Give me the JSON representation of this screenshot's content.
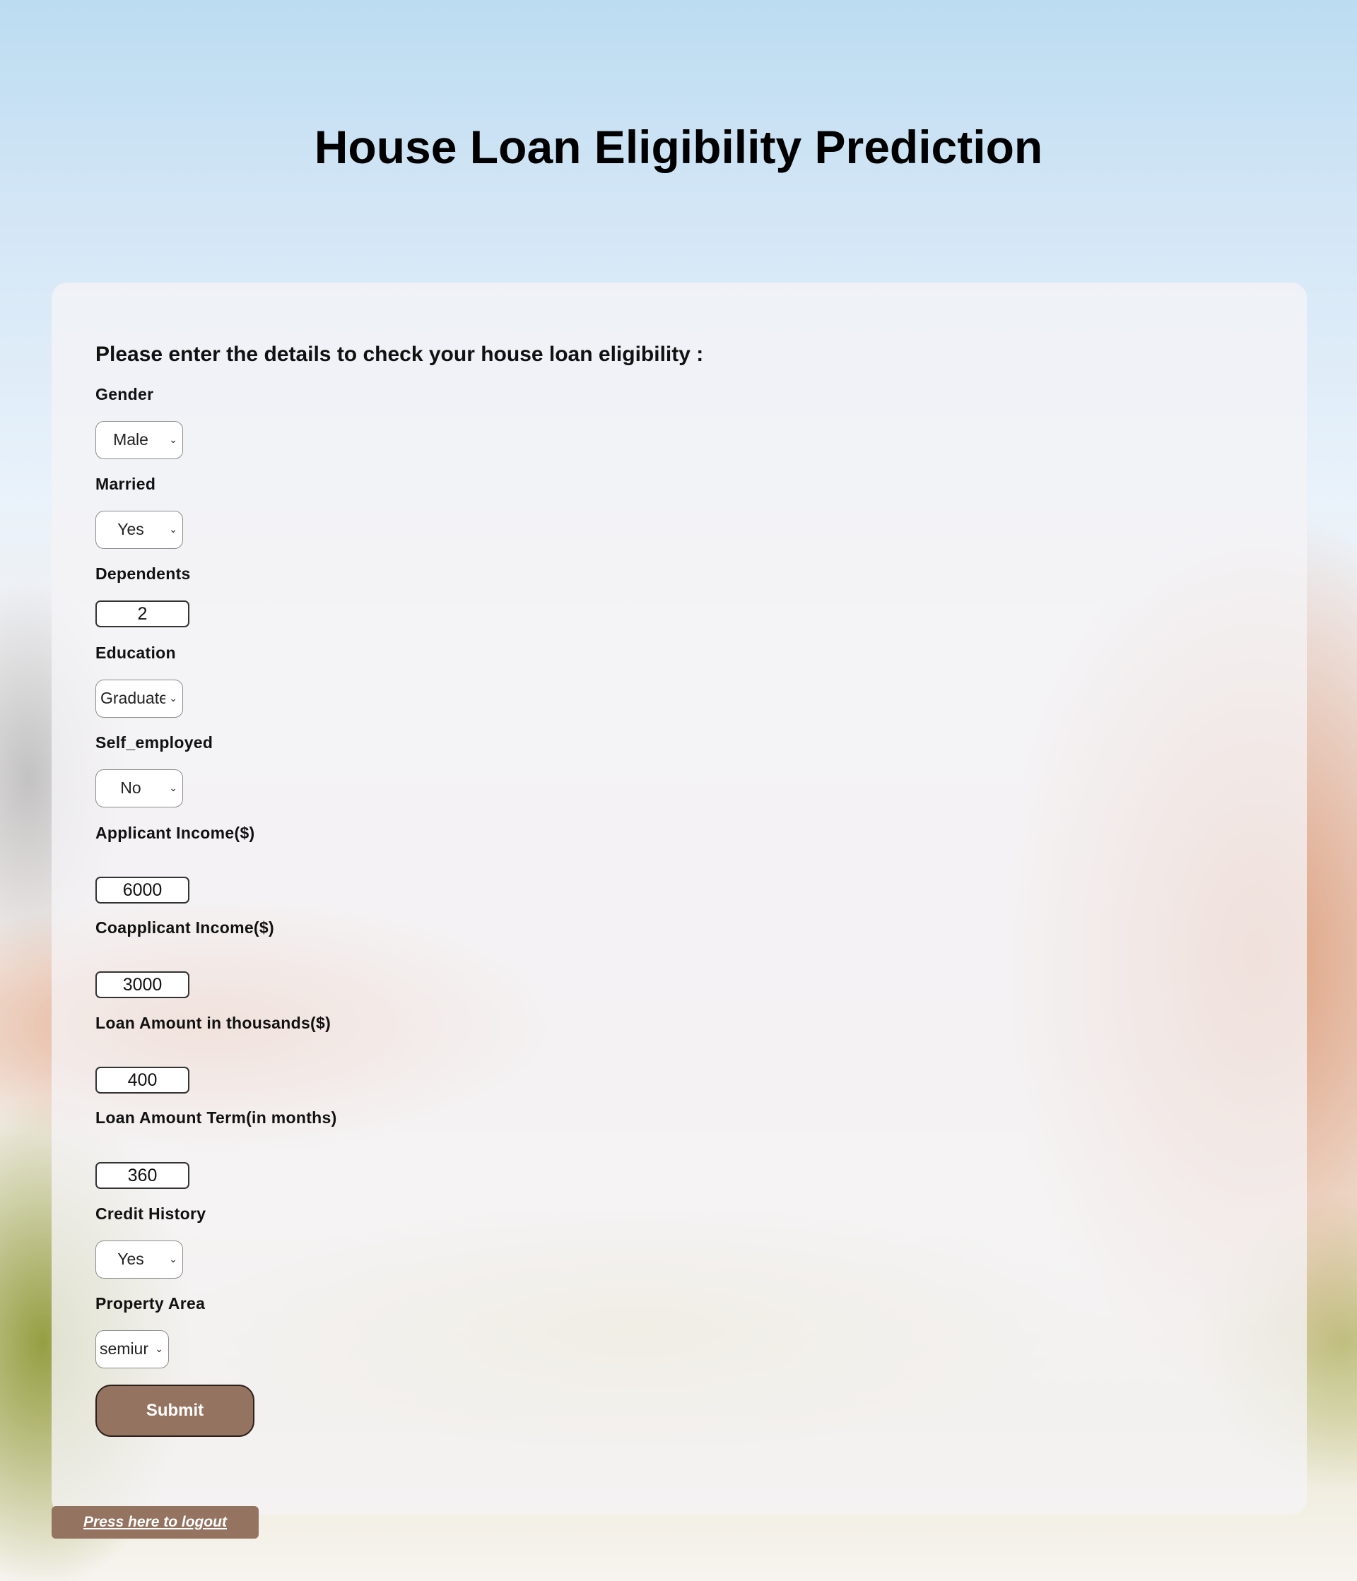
{
  "page": {
    "title": "House Loan Eligibility Prediction"
  },
  "form": {
    "heading": "Please enter the details to check your house loan eligibility :",
    "fields": {
      "gender": {
        "label": "Gender",
        "value": "Male"
      },
      "married": {
        "label": "Married",
        "value": "Yes"
      },
      "dependents": {
        "label": "Dependents",
        "value": "2"
      },
      "education": {
        "label": "Education",
        "value": "Graduate"
      },
      "self_employed": {
        "label": "Self_employed",
        "value": "No"
      },
      "applicant_income": {
        "label": "Applicant Income($)",
        "value": "6000"
      },
      "coapplicant_income": {
        "label": "Coapplicant Income($)",
        "value": "3000"
      },
      "loan_amount": {
        "label": "Loan Amount in thousands($)",
        "value": "400"
      },
      "loan_term": {
        "label": "Loan Amount Term(in months)",
        "value": "360"
      },
      "credit_history": {
        "label": "Credit History",
        "value": "Yes"
      },
      "property_area": {
        "label": "Property Area",
        "value": "semiur"
      }
    },
    "submit_label": "Submit"
  },
  "logout": {
    "label": "Press here to logout"
  },
  "colors": {
    "button_brown": "#957361",
    "card_background": "#f5f3f6"
  },
  "icons": {
    "select_arrow": "chevron-down-icon"
  }
}
